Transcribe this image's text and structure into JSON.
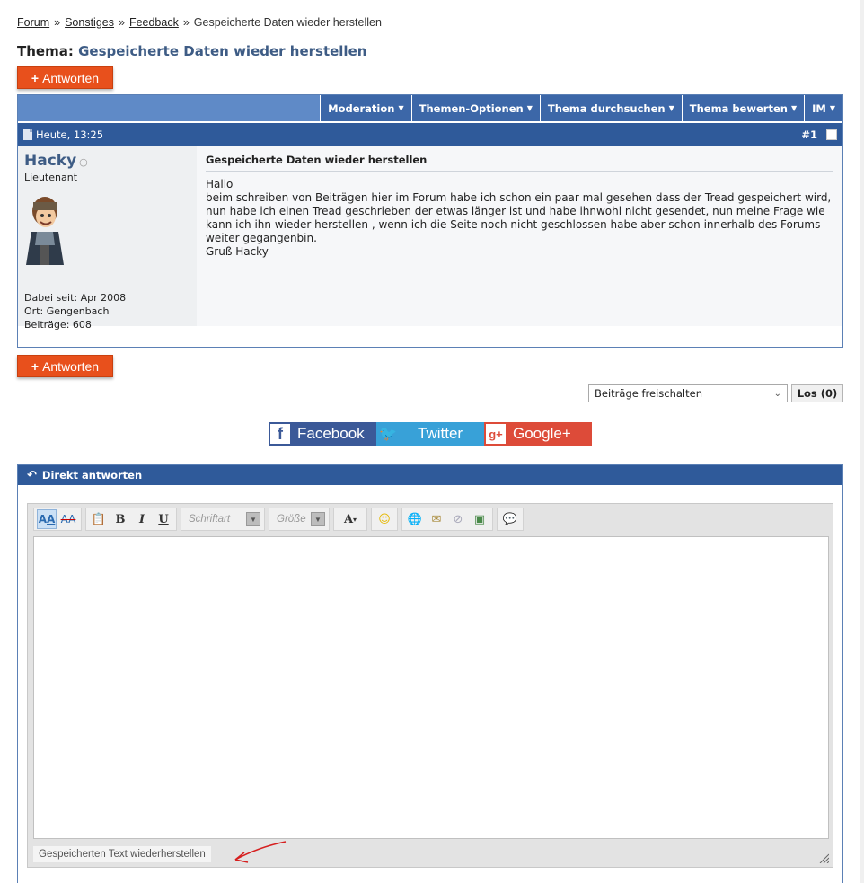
{
  "breadcrumb": {
    "items": [
      "Forum",
      "Sonstiges",
      "Feedback"
    ],
    "separator": "»",
    "current": "Gespeicherte Daten wieder herstellen"
  },
  "thread": {
    "label": "Thema:",
    "title": "Gespeicherte Daten wieder herstellen"
  },
  "reply_button": {
    "plus": "+",
    "label": "Antworten"
  },
  "toolbar": {
    "items": [
      "Moderation",
      "Themen-Optionen",
      "Thema durchsuchen",
      "Thema bewerten",
      "IM"
    ]
  },
  "post": {
    "date": "Heute, 13:25",
    "number": "#1",
    "user": {
      "name": "Hacky",
      "status_icon": "offline-circle-icon",
      "rank": "Lieutenant",
      "joined": "Dabei seit: Apr 2008",
      "location": "Ort: Gengenbach",
      "posts": "Beiträge: 608"
    },
    "title": "Gespeicherte Daten wieder herstellen",
    "text": "Hallo\nbeim schreiben von Beiträgen hier im Forum habe ich schon ein paar mal gesehen dass der Tread gespeichert wird, nun habe ich einen Tread geschrieben der etwas länger ist und habe ihnwohl nicht gesendet, nun meine Frage wie kann ich ihn wieder herstellen , wenn ich die Seite noch nicht geschlossen habe aber schon innerhalb des Forums weiter gegangenbin.\nGruß Hacky"
  },
  "moderation": {
    "select_value": "Beiträge freischalten",
    "go_label": "Los (0)"
  },
  "social": {
    "facebook": "Facebook",
    "twitter": "Twitter",
    "googleplus": "Google+",
    "facebook_color": "#3b5998",
    "twitter_color": "#38a1d8",
    "googleplus_color": "#dd4b39"
  },
  "quick_reply": {
    "header": "Direkt antworten",
    "font_placeholder": "Schriftart",
    "size_placeholder": "Größe",
    "restore_label": "Gespeicherten Text wiederherstellen"
  },
  "colors": {
    "accent": "#e8501c",
    "header_blue": "#2f5a9a",
    "toolbar_blue": "#5f8ac7",
    "title_blue": "#3e5c85"
  }
}
